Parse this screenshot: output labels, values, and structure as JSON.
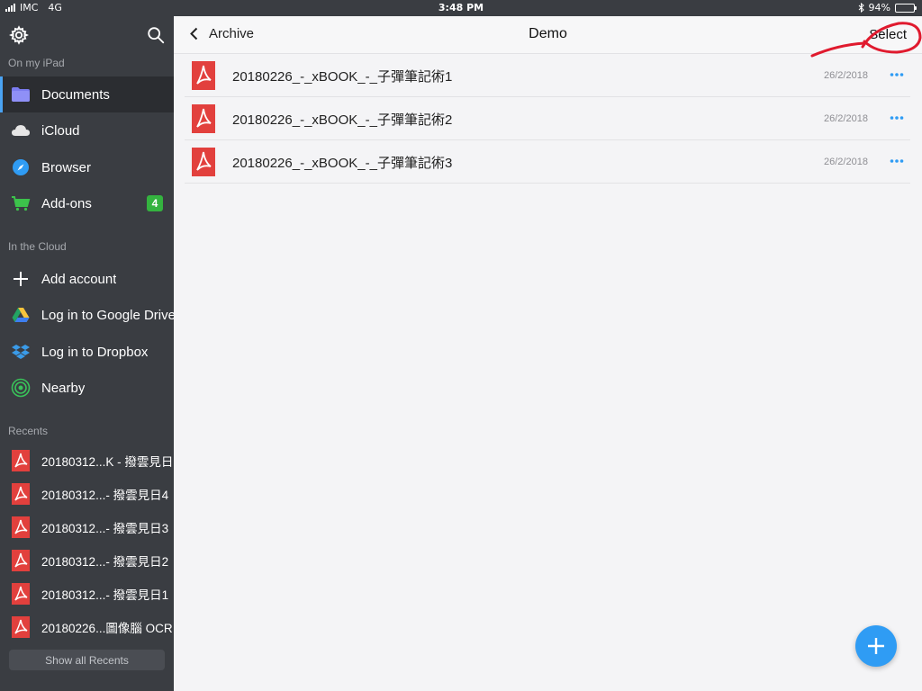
{
  "status_bar": {
    "carrier": "IMC",
    "network": "4G",
    "time": "3:48 PM",
    "battery": "94%",
    "battery_level": 0.94
  },
  "sidebar": {
    "settings_icon": "gear-icon",
    "search_icon": "search-icon",
    "section_on_ipad": "On my iPad",
    "on_ipad_items": [
      {
        "label": "Documents",
        "icon": "folder-icon",
        "active": true
      },
      {
        "label": "iCloud",
        "icon": "cloud-icon"
      },
      {
        "label": "Browser",
        "icon": "compass-icon"
      },
      {
        "label": "Add-ons",
        "icon": "cart-icon",
        "badge": "4"
      }
    ],
    "section_cloud": "In the Cloud",
    "cloud_items": [
      {
        "label": "Add account",
        "icon": "plus-icon"
      },
      {
        "label": "Log in to Google Drive",
        "icon": "google-drive-icon"
      },
      {
        "label": "Log in to Dropbox",
        "icon": "dropbox-icon"
      },
      {
        "label": "Nearby",
        "icon": "nearby-icon"
      }
    ],
    "section_recents": "Recents",
    "recents": [
      {
        "label": "20180312...K - 撥雲見日"
      },
      {
        "label": "20180312...- 撥雲見日4"
      },
      {
        "label": "20180312...- 撥雲見日3"
      },
      {
        "label": "20180312...- 撥雲見日2"
      },
      {
        "label": "20180312...- 撥雲見日1"
      },
      {
        "label": "20180226...圖像腦 OCR"
      }
    ],
    "show_all_label": "Show all Recents"
  },
  "main": {
    "back_label": "Archive",
    "title": "Demo",
    "select_label": "Select",
    "files": [
      {
        "name": "20180226_-_xBOOK_-_子彈筆記術1",
        "date": "26/2/2018"
      },
      {
        "name": "20180226_-_xBOOK_-_子彈筆記術2",
        "date": "26/2/2018"
      },
      {
        "name": "20180226_-_xBOOK_-_子彈筆記術3",
        "date": "26/2/2018"
      }
    ]
  },
  "colors": {
    "sidebar_bg": "#3a3d42",
    "accent_blue": "#2f9cf4",
    "pdf_red": "#e2403d",
    "badge_green": "#34b33f",
    "annotation_red": "#e01a2e"
  }
}
